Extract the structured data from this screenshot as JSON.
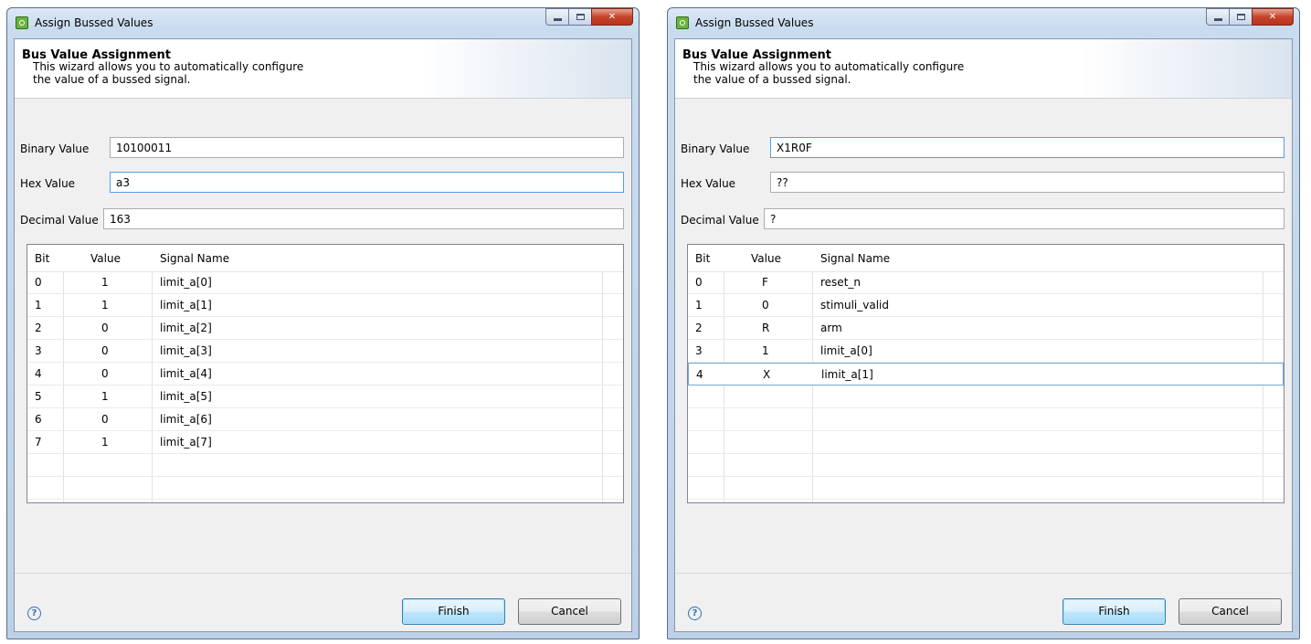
{
  "dialogs": [
    {
      "title": "Assign Bussed Values",
      "banner_title": "Bus Value Assignment",
      "banner_line1": "This wizard allows you to automatically configure",
      "banner_line2": "the value of a bussed signal.",
      "binary_label": "Binary Value",
      "binary_value": "10100011",
      "hex_label": "Hex Value",
      "hex_value": "a3",
      "decimal_label": "Decimal Value",
      "decimal_value": "163",
      "columns": [
        "Bit",
        "Value",
        "Signal Name"
      ],
      "rows": [
        {
          "bit": "0",
          "value": "1",
          "signal": "limit_a[0]"
        },
        {
          "bit": "1",
          "value": "1",
          "signal": "limit_a[1]"
        },
        {
          "bit": "2",
          "value": "0",
          "signal": "limit_a[2]"
        },
        {
          "bit": "3",
          "value": "0",
          "signal": "limit_a[3]"
        },
        {
          "bit": "4",
          "value": "0",
          "signal": "limit_a[4]"
        },
        {
          "bit": "5",
          "value": "1",
          "signal": "limit_a[5]"
        },
        {
          "bit": "6",
          "value": "0",
          "signal": "limit_a[6]"
        },
        {
          "bit": "7",
          "value": "1",
          "signal": "limit_a[7]"
        }
      ],
      "finish_label": "Finish",
      "cancel_label": "Cancel",
      "help_glyph": "?"
    },
    {
      "title": "Assign Bussed Values",
      "banner_title": "Bus Value Assignment",
      "banner_line1": "This wizard allows you to automatically configure",
      "banner_line2": "the value of a bussed signal.",
      "binary_label": "Binary Value",
      "binary_value": "X1R0F",
      "hex_label": "Hex Value",
      "hex_value": "??",
      "decimal_label": "Decimal Value",
      "decimal_value": "?",
      "columns": [
        "Bit",
        "Value",
        "Signal Name"
      ],
      "rows": [
        {
          "bit": "0",
          "value": "F",
          "signal": "reset_n"
        },
        {
          "bit": "1",
          "value": "0",
          "signal": "stimuli_valid"
        },
        {
          "bit": "2",
          "value": "R",
          "signal": "arm"
        },
        {
          "bit": "3",
          "value": "1",
          "signal": "limit_a[0]"
        },
        {
          "bit": "4",
          "value": "X",
          "signal": "limit_a[1]"
        }
      ],
      "finish_label": "Finish",
      "cancel_label": "Cancel",
      "help_glyph": "?"
    }
  ]
}
